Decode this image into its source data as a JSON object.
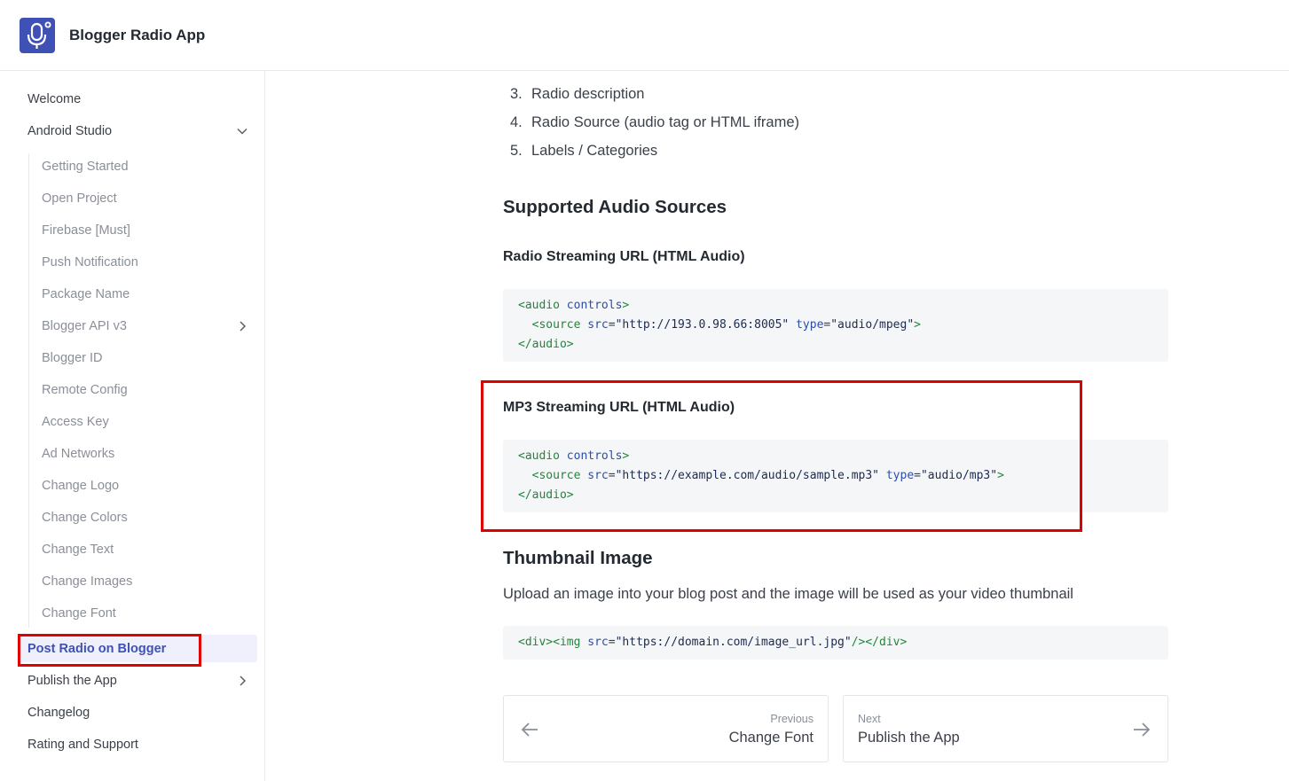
{
  "header": {
    "app_title": "Blogger Radio App",
    "logo_icon": "microphone-icon",
    "brand_color": "#3f51b5"
  },
  "sidebar": {
    "welcome": "Welcome",
    "android_studio": "Android Studio",
    "android_sub": [
      "Getting Started",
      "Open Project",
      "Firebase [Must]",
      "Push Notification",
      "Package Name",
      "Blogger API v3",
      "Blogger ID",
      "Remote Config",
      "Access Key",
      "Ad Networks",
      "Change Logo",
      "Change Colors",
      "Change Text",
      "Change Images",
      "Change Font"
    ],
    "active": "Post Radio on Blogger",
    "publish": "Publish the App",
    "changelog": "Changelog",
    "rating": "Rating and Support"
  },
  "content": {
    "list": [
      {
        "num": "3.",
        "text": "Radio description"
      },
      {
        "num": "4.",
        "text": "Radio Source (audio tag or HTML iframe)"
      },
      {
        "num": "5.",
        "text": "Labels / Categories"
      }
    ],
    "supported_heading": "Supported Audio Sources",
    "radio_heading": "Radio Streaming URL (HTML Audio)",
    "radio_code": {
      "open": "<audio",
      "attr_controls": "controls",
      "close_bracket": ">",
      "source_tag": "<source",
      "src_attr": "src",
      "src_value": "\"http://193.0.98.66:8005\"",
      "type_attr": "type",
      "type_value": "\"audio/mpeg\"",
      "end": "</audio>"
    },
    "mp3_heading": "MP3 Streaming URL (HTML Audio)",
    "mp3_code": {
      "src_value": "\"https://example.com/audio/sample.mp3\"",
      "type_value": "\"audio/mp3\""
    },
    "thumb_heading": "Thumbnail Image",
    "thumb_text": "Upload an image into your blog post and the image will be used as your video thumbnail",
    "thumb_code": {
      "open": "<div><img",
      "src_attr": "src",
      "src_value": "\"https://domain.com/image_url.jpg\"",
      "end": "/></div>"
    }
  },
  "pager": {
    "prev_label": "Previous",
    "prev_title": "Change Font",
    "next_label": "Next",
    "next_title": "Publish the App"
  },
  "highlight_color": "#e00000"
}
